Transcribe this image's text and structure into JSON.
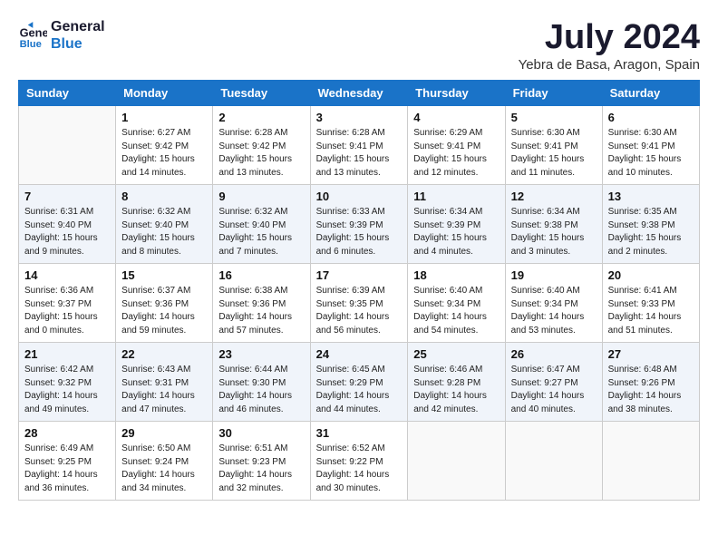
{
  "header": {
    "logo_line1": "General",
    "logo_line2": "Blue",
    "month": "July 2024",
    "location": "Yebra de Basa, Aragon, Spain"
  },
  "weekdays": [
    "Sunday",
    "Monday",
    "Tuesday",
    "Wednesday",
    "Thursday",
    "Friday",
    "Saturday"
  ],
  "weeks": [
    [
      {
        "day": "",
        "info": ""
      },
      {
        "day": "1",
        "info": "Sunrise: 6:27 AM\nSunset: 9:42 PM\nDaylight: 15 hours\nand 14 minutes."
      },
      {
        "day": "2",
        "info": "Sunrise: 6:28 AM\nSunset: 9:42 PM\nDaylight: 15 hours\nand 13 minutes."
      },
      {
        "day": "3",
        "info": "Sunrise: 6:28 AM\nSunset: 9:41 PM\nDaylight: 15 hours\nand 13 minutes."
      },
      {
        "day": "4",
        "info": "Sunrise: 6:29 AM\nSunset: 9:41 PM\nDaylight: 15 hours\nand 12 minutes."
      },
      {
        "day": "5",
        "info": "Sunrise: 6:30 AM\nSunset: 9:41 PM\nDaylight: 15 hours\nand 11 minutes."
      },
      {
        "day": "6",
        "info": "Sunrise: 6:30 AM\nSunset: 9:41 PM\nDaylight: 15 hours\nand 10 minutes."
      }
    ],
    [
      {
        "day": "7",
        "info": "Sunrise: 6:31 AM\nSunset: 9:40 PM\nDaylight: 15 hours\nand 9 minutes."
      },
      {
        "day": "8",
        "info": "Sunrise: 6:32 AM\nSunset: 9:40 PM\nDaylight: 15 hours\nand 8 minutes."
      },
      {
        "day": "9",
        "info": "Sunrise: 6:32 AM\nSunset: 9:40 PM\nDaylight: 15 hours\nand 7 minutes."
      },
      {
        "day": "10",
        "info": "Sunrise: 6:33 AM\nSunset: 9:39 PM\nDaylight: 15 hours\nand 6 minutes."
      },
      {
        "day": "11",
        "info": "Sunrise: 6:34 AM\nSunset: 9:39 PM\nDaylight: 15 hours\nand 4 minutes."
      },
      {
        "day": "12",
        "info": "Sunrise: 6:34 AM\nSunset: 9:38 PM\nDaylight: 15 hours\nand 3 minutes."
      },
      {
        "day": "13",
        "info": "Sunrise: 6:35 AM\nSunset: 9:38 PM\nDaylight: 15 hours\nand 2 minutes."
      }
    ],
    [
      {
        "day": "14",
        "info": "Sunrise: 6:36 AM\nSunset: 9:37 PM\nDaylight: 15 hours\nand 0 minutes."
      },
      {
        "day": "15",
        "info": "Sunrise: 6:37 AM\nSunset: 9:36 PM\nDaylight: 14 hours\nand 59 minutes."
      },
      {
        "day": "16",
        "info": "Sunrise: 6:38 AM\nSunset: 9:36 PM\nDaylight: 14 hours\nand 57 minutes."
      },
      {
        "day": "17",
        "info": "Sunrise: 6:39 AM\nSunset: 9:35 PM\nDaylight: 14 hours\nand 56 minutes."
      },
      {
        "day": "18",
        "info": "Sunrise: 6:40 AM\nSunset: 9:34 PM\nDaylight: 14 hours\nand 54 minutes."
      },
      {
        "day": "19",
        "info": "Sunrise: 6:40 AM\nSunset: 9:34 PM\nDaylight: 14 hours\nand 53 minutes."
      },
      {
        "day": "20",
        "info": "Sunrise: 6:41 AM\nSunset: 9:33 PM\nDaylight: 14 hours\nand 51 minutes."
      }
    ],
    [
      {
        "day": "21",
        "info": "Sunrise: 6:42 AM\nSunset: 9:32 PM\nDaylight: 14 hours\nand 49 minutes."
      },
      {
        "day": "22",
        "info": "Sunrise: 6:43 AM\nSunset: 9:31 PM\nDaylight: 14 hours\nand 47 minutes."
      },
      {
        "day": "23",
        "info": "Sunrise: 6:44 AM\nSunset: 9:30 PM\nDaylight: 14 hours\nand 46 minutes."
      },
      {
        "day": "24",
        "info": "Sunrise: 6:45 AM\nSunset: 9:29 PM\nDaylight: 14 hours\nand 44 minutes."
      },
      {
        "day": "25",
        "info": "Sunrise: 6:46 AM\nSunset: 9:28 PM\nDaylight: 14 hours\nand 42 minutes."
      },
      {
        "day": "26",
        "info": "Sunrise: 6:47 AM\nSunset: 9:27 PM\nDaylight: 14 hours\nand 40 minutes."
      },
      {
        "day": "27",
        "info": "Sunrise: 6:48 AM\nSunset: 9:26 PM\nDaylight: 14 hours\nand 38 minutes."
      }
    ],
    [
      {
        "day": "28",
        "info": "Sunrise: 6:49 AM\nSunset: 9:25 PM\nDaylight: 14 hours\nand 36 minutes."
      },
      {
        "day": "29",
        "info": "Sunrise: 6:50 AM\nSunset: 9:24 PM\nDaylight: 14 hours\nand 34 minutes."
      },
      {
        "day": "30",
        "info": "Sunrise: 6:51 AM\nSunset: 9:23 PM\nDaylight: 14 hours\nand 32 minutes."
      },
      {
        "day": "31",
        "info": "Sunrise: 6:52 AM\nSunset: 9:22 PM\nDaylight: 14 hours\nand 30 minutes."
      },
      {
        "day": "",
        "info": ""
      },
      {
        "day": "",
        "info": ""
      },
      {
        "day": "",
        "info": ""
      }
    ]
  ]
}
